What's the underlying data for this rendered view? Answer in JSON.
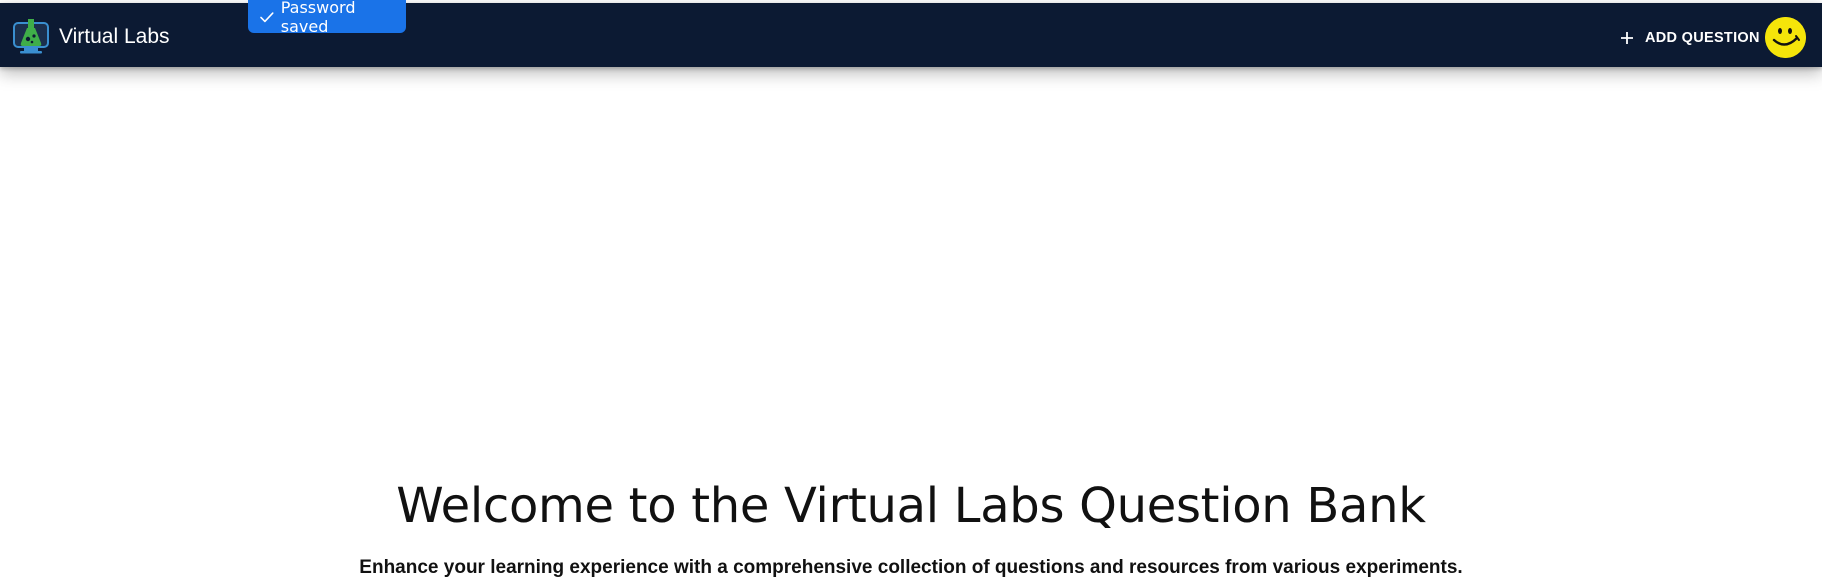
{
  "header": {
    "brand_title": "Virtual Labs",
    "add_question_label": "ADD QUESTION",
    "background_color": "#0c1a33"
  },
  "toast": {
    "message": "Password saved",
    "background_color": "#1a73e8"
  },
  "avatar": {
    "icon": "smiley-icon",
    "color": "#f5e50a"
  },
  "main": {
    "title": "Welcome to the Virtual Labs Question Bank",
    "subtitle": "Enhance your learning experience with a comprehensive collection of questions and resources from various experiments."
  }
}
